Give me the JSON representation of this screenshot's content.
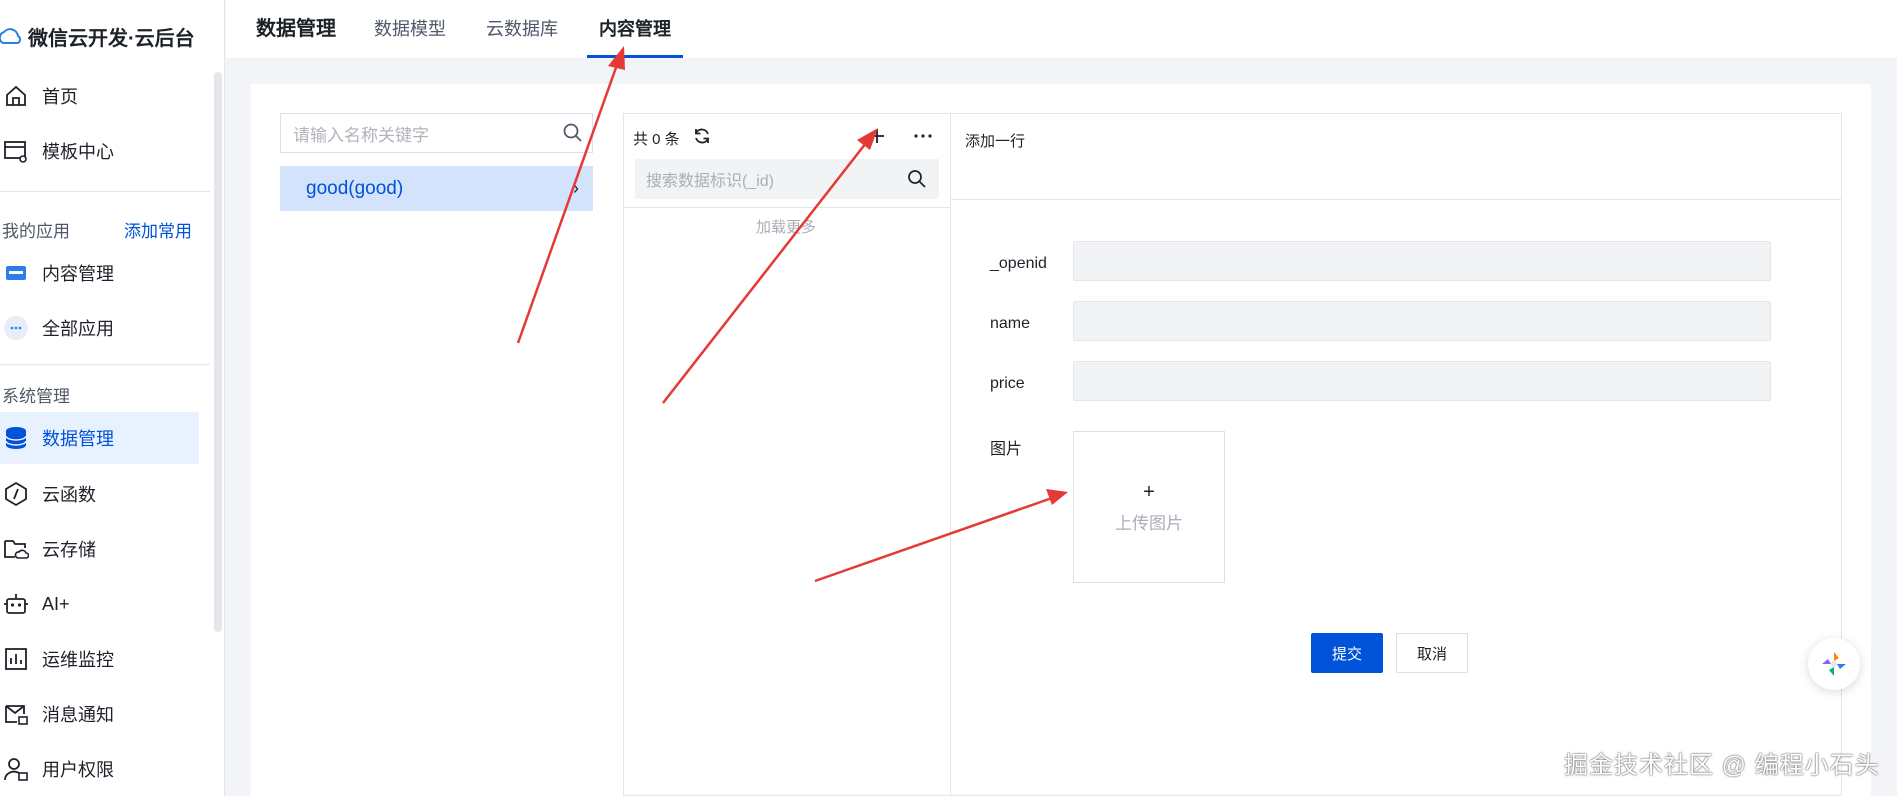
{
  "brand": {
    "title": "微信云开发·云后台"
  },
  "sidebar": {
    "items_top": [
      {
        "label": "首页",
        "icon": "home-icon"
      },
      {
        "label": "模板中心",
        "icon": "template-icon"
      }
    ],
    "my_apps": {
      "label": "我的应用",
      "add_label": "添加常用"
    },
    "apps": [
      {
        "label": "内容管理",
        "icon": "cms-icon"
      },
      {
        "label": "全部应用",
        "icon": "more-apps-icon"
      }
    ],
    "system": {
      "label": "系统管理"
    },
    "system_items": [
      {
        "label": "数据管理",
        "icon": "database-icon",
        "active": true
      },
      {
        "label": "云函数",
        "icon": "function-icon"
      },
      {
        "label": "云存储",
        "icon": "storage-icon"
      },
      {
        "label": "AI+",
        "icon": "robot-icon"
      },
      {
        "label": "运维监控",
        "icon": "monitor-icon"
      },
      {
        "label": "消息通知",
        "icon": "message-icon"
      },
      {
        "label": "用户权限",
        "icon": "user-permission-icon"
      }
    ]
  },
  "topbar": {
    "title": "数据管理",
    "tabs": [
      {
        "label": "数据模型"
      },
      {
        "label": "云数据库"
      },
      {
        "label": "内容管理",
        "selected": true
      }
    ]
  },
  "models": {
    "search_placeholder": "请输入名称关键字",
    "items": [
      {
        "label": "good(good)",
        "selected": true
      }
    ]
  },
  "records": {
    "count_label": "共 0 条",
    "search_placeholder": "搜索数据标识(_id)",
    "load_more": "加载更多"
  },
  "form": {
    "title": "添加一行",
    "fields": [
      {
        "label": "_openid",
        "value": ""
      },
      {
        "label": "name",
        "value": ""
      },
      {
        "label": "price",
        "value": ""
      }
    ],
    "image": {
      "label": "图片",
      "upload_plus": "+",
      "upload_text": "上传图片"
    },
    "submit": "提交",
    "cancel": "取消"
  },
  "annotations": {
    "arrow_color": "#e53935"
  },
  "watermark": "掘金技术社区 @ 编程小石头",
  "colors": {
    "primary": "#0052d9",
    "active_bg": "#e8f1fe",
    "selected_bg": "#d4e3fc"
  }
}
